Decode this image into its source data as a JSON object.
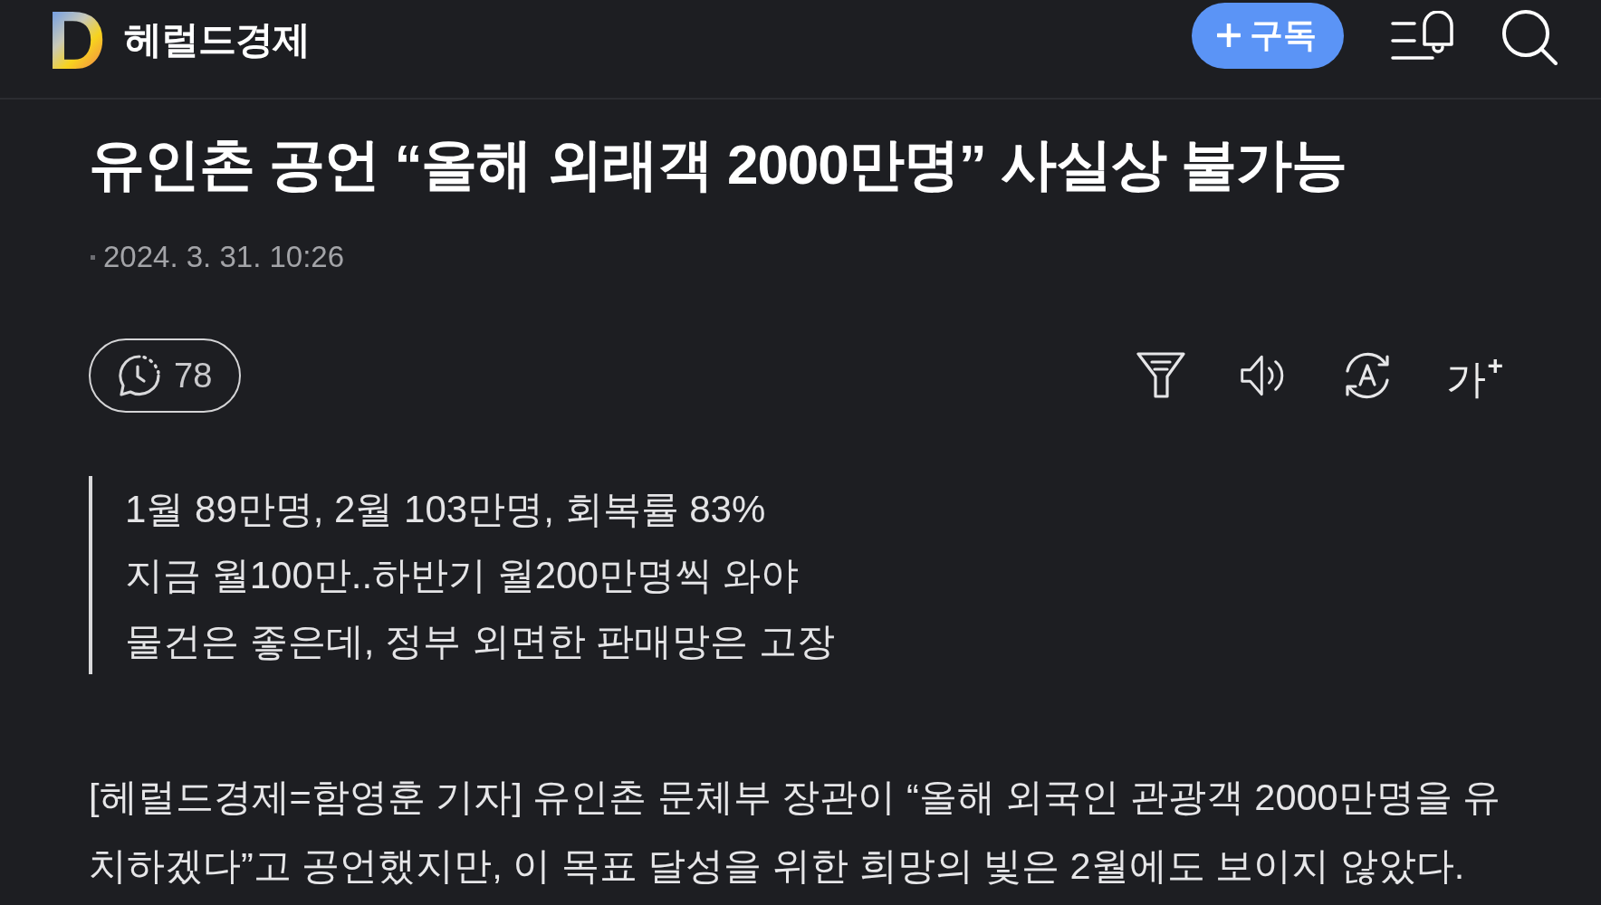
{
  "header": {
    "logo": "D",
    "brand": "헤럴드경제",
    "subscribe_button": "구독"
  },
  "article": {
    "title": "유인촌 공언 “올해 외래객 2000만명” 사실상 불가능",
    "date": "2024. 3. 31. 10:26",
    "comment_count": "78",
    "text_size_button": "가$^{+}$",
    "summary": [
      "1월 89만명, 2월 103만명, 회복률 83%",
      "지금 월100만..하반기 월200만명씩 와야",
      "물건은 좋은데, 정부 외면한 판매망은 고장"
    ],
    "body": "[헤럴드경제=함영훈 기자] 유인촌 문체부 장관이 “올해 외국인 관광객 2000만명을 유치하겠다”고 공언했지만, 이 목표 달성을 위한 희망의 빛은 2월에도 보이지 않았다."
  }
}
